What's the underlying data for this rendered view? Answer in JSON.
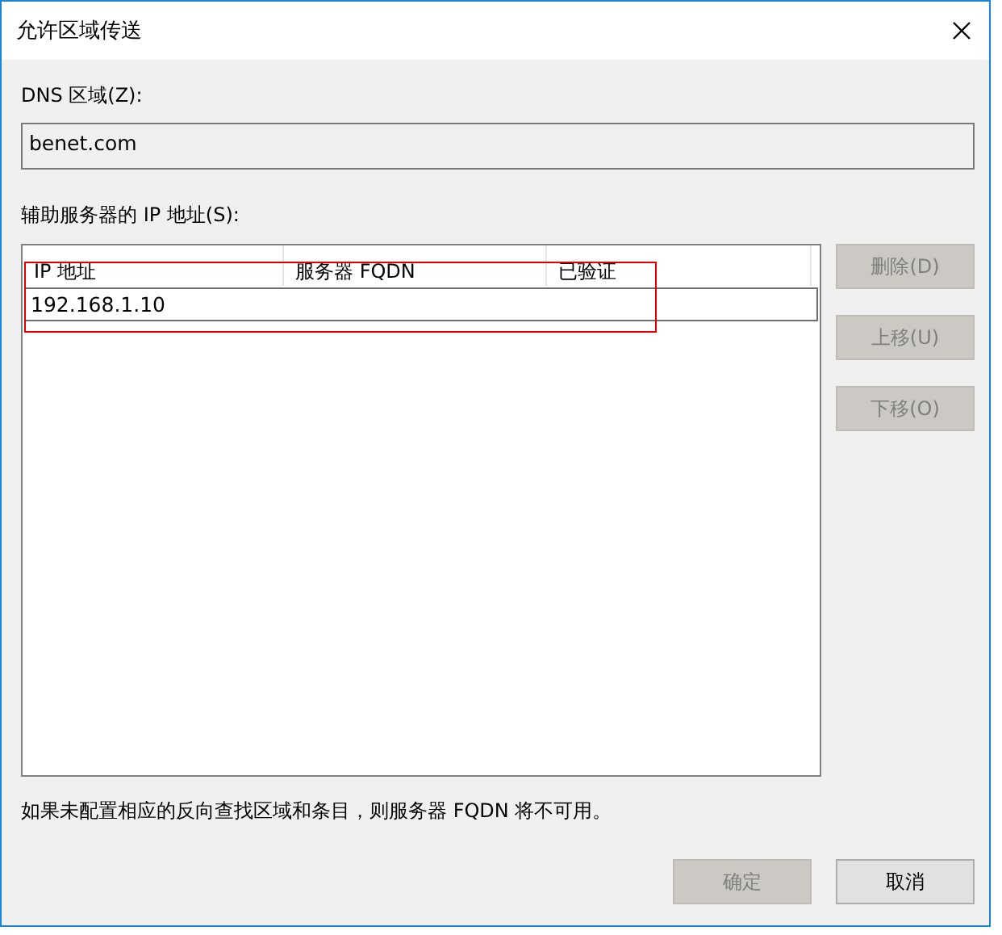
{
  "window": {
    "title": "允许区域传送"
  },
  "zone": {
    "label": "DNS 区域(Z):",
    "value": "benet.com"
  },
  "servers": {
    "label": "辅助服务器的 IP 地址(S):",
    "columns": [
      "IP 地址",
      "服务器 FQDN",
      "已验证"
    ],
    "rows": [
      {
        "cells": [
          "192.168.1.10",
          "",
          ""
        ],
        "selected": true
      }
    ]
  },
  "side_buttons": [
    {
      "label": "删除(D)",
      "disabled": true
    },
    {
      "label": "上移(U)",
      "disabled": true
    },
    {
      "label": "下移(O)",
      "disabled": true
    }
  ],
  "note": "如果未配置相应的反向查找区域和条目，则服务器 FQDN 将不可用。",
  "buttons": [
    {
      "label": "确定",
      "disabled": true
    },
    {
      "label": "取消",
      "disabled": false
    }
  ]
}
